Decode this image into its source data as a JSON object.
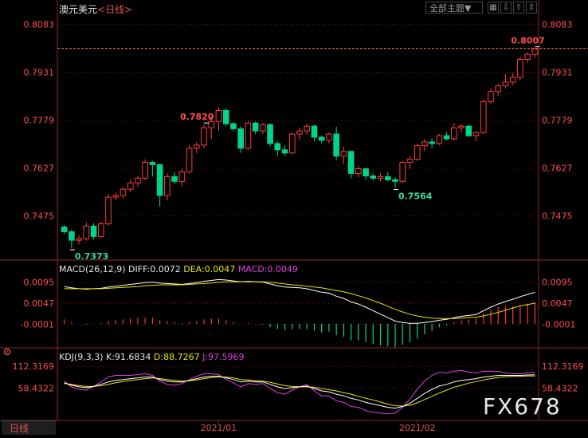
{
  "header": {
    "instrument": "澳元美元",
    "period": "<日线>",
    "mode_select": "全部主题▼",
    "toolbar_icons": [
      "grid-icon",
      "down-arrow-icon",
      "up-arrow-icon",
      "expand-icon"
    ]
  },
  "macd_legend": {
    "name": "MACD(26,12,9)",
    "diff": "DIFF:0.0072",
    "dea": "DEA:0.0047",
    "macd": "MACD:0.0049"
  },
  "kdj_legend": {
    "name": "KDJ(9,3,3)",
    "k": "K:91.6834",
    "d": "D:88.7267",
    "j": "J:97.5969"
  },
  "period_tab": "日线",
  "watermark": "FX678",
  "colors": {
    "up": "#ff3b3b",
    "down": "#00d48a",
    "grid": "#7a1e1e",
    "axis_text": "#ff4d4d",
    "diff": "#ffffff",
    "dea": "#e6e600",
    "macd_hist_pos": "#ff3b3b",
    "macd_hist_neg": "#00d48a",
    "k": "#ffffff",
    "d": "#e6e600",
    "j": "#e040e0"
  },
  "chart_data": [
    {
      "type": "candlestick",
      "title": "澳元美元<日线>",
      "yticks": [
        "0.8083",
        "0.7931",
        "0.7779",
        "0.7627",
        "0.7475"
      ],
      "ylim": [
        0.7335,
        0.8115
      ],
      "x_labels": [
        "2021/01",
        "2021/02"
      ],
      "price_line": 0.8007,
      "annotations": [
        {
          "label": "0.7820",
          "kind": "high",
          "index": 19
        },
        {
          "label": "0.7373",
          "kind": "low",
          "index": 1
        },
        {
          "label": "0.7564",
          "kind": "low",
          "index": 45
        },
        {
          "label": "0.8007",
          "kind": "high",
          "index": 64
        }
      ],
      "ohlc": [
        [
          0.744,
          0.7447,
          0.7418,
          0.7425
        ],
        [
          0.7425,
          0.7432,
          0.7373,
          0.7398
        ],
        [
          0.7398,
          0.7415,
          0.7385,
          0.7403
        ],
        [
          0.7403,
          0.7455,
          0.7397,
          0.7443
        ],
        [
          0.7443,
          0.7452,
          0.74,
          0.741
        ],
        [
          0.741,
          0.7458,
          0.7405,
          0.745
        ],
        [
          0.745,
          0.7545,
          0.7445,
          0.7535
        ],
        [
          0.7535,
          0.755,
          0.7525,
          0.754
        ],
        [
          0.754,
          0.7565,
          0.753,
          0.756
        ],
        [
          0.756,
          0.7592,
          0.755,
          0.758
        ],
        [
          0.758,
          0.7602,
          0.7568,
          0.7595
        ],
        [
          0.7595,
          0.7655,
          0.7588,
          0.7645
        ],
        [
          0.7645,
          0.765,
          0.76,
          0.7638
        ],
        [
          0.7638,
          0.764,
          0.7505,
          0.754
        ],
        [
          0.754,
          0.761,
          0.7525,
          0.76
        ],
        [
          0.76,
          0.7615,
          0.7575,
          0.7585
        ],
        [
          0.7585,
          0.7625,
          0.757,
          0.7615
        ],
        [
          0.7615,
          0.77,
          0.761,
          0.769
        ],
        [
          0.769,
          0.771,
          0.7675,
          0.77
        ],
        [
          0.77,
          0.7765,
          0.769,
          0.7755
        ],
        [
          0.7755,
          0.779,
          0.772,
          0.7775
        ],
        [
          0.7775,
          0.782,
          0.7745,
          0.781
        ],
        [
          0.781,
          0.7818,
          0.776,
          0.7768
        ],
        [
          0.7768,
          0.7773,
          0.7745,
          0.7752
        ],
        [
          0.7752,
          0.776,
          0.7675,
          0.769
        ],
        [
          0.769,
          0.7775,
          0.7685,
          0.777
        ],
        [
          0.777,
          0.7775,
          0.7735,
          0.7745
        ],
        [
          0.7745,
          0.777,
          0.7735,
          0.7765
        ],
        [
          0.7765,
          0.7768,
          0.7695,
          0.7705
        ],
        [
          0.7705,
          0.7712,
          0.7665,
          0.7685
        ],
        [
          0.7685,
          0.77,
          0.7665,
          0.7675
        ],
        [
          0.7675,
          0.774,
          0.767,
          0.7735
        ],
        [
          0.7735,
          0.7755,
          0.7715,
          0.7745
        ],
        [
          0.7745,
          0.7768,
          0.7733,
          0.776
        ],
        [
          0.776,
          0.7765,
          0.7712,
          0.7725
        ],
        [
          0.7725,
          0.773,
          0.7705,
          0.7715
        ],
        [
          0.7715,
          0.774,
          0.7705,
          0.7735
        ],
        [
          0.7735,
          0.7758,
          0.7652,
          0.7665
        ],
        [
          0.7665,
          0.7695,
          0.764,
          0.768
        ],
        [
          0.768,
          0.7682,
          0.7595,
          0.761
        ],
        [
          0.761,
          0.7635,
          0.7598,
          0.7625
        ],
        [
          0.7625,
          0.7628,
          0.759,
          0.7602
        ],
        [
          0.7602,
          0.761,
          0.7586,
          0.7595
        ],
        [
          0.7595,
          0.761,
          0.7585,
          0.76
        ],
        [
          0.76,
          0.7615,
          0.7585,
          0.759
        ],
        [
          0.759,
          0.7598,
          0.7564,
          0.7585
        ],
        [
          0.7585,
          0.765,
          0.758,
          0.7645
        ],
        [
          0.7645,
          0.7665,
          0.7625,
          0.7655
        ],
        [
          0.7655,
          0.7705,
          0.765,
          0.7698
        ],
        [
          0.7698,
          0.772,
          0.7682,
          0.771
        ],
        [
          0.771,
          0.7722,
          0.769,
          0.7705
        ],
        [
          0.7705,
          0.7735,
          0.77,
          0.773
        ],
        [
          0.773,
          0.7742,
          0.7715,
          0.772
        ],
        [
          0.772,
          0.777,
          0.7715,
          0.7755
        ],
        [
          0.7755,
          0.7768,
          0.774,
          0.776
        ],
        [
          0.776,
          0.7765,
          0.7725,
          0.773
        ],
        [
          0.773,
          0.7745,
          0.7712,
          0.774
        ],
        [
          0.774,
          0.7845,
          0.7735,
          0.7838
        ],
        [
          0.7838,
          0.788,
          0.7832,
          0.787
        ],
        [
          0.787,
          0.7895,
          0.7855,
          0.7888
        ],
        [
          0.7888,
          0.7925,
          0.788,
          0.79
        ],
        [
          0.79,
          0.7928,
          0.789,
          0.7915
        ],
        [
          0.7915,
          0.798,
          0.7905,
          0.7972
        ],
        [
          0.7972,
          0.7995,
          0.796,
          0.7988
        ],
        [
          0.7988,
          0.8007,
          0.7978,
          0.8005
        ]
      ]
    },
    {
      "type": "line+bar",
      "title": "MACD(26,12,9)",
      "yticks": [
        "0.0095",
        "0.0047",
        "-0.0001"
      ],
      "ylim": [
        -0.0055,
        0.012
      ],
      "series": [
        {
          "name": "DIFF",
          "values": [
            0.0085,
            0.0082,
            0.008,
            0.0079,
            0.008,
            0.0081,
            0.0084,
            0.0086,
            0.0088,
            0.009,
            0.0092,
            0.0094,
            0.0095,
            0.0093,
            0.0092,
            0.0091,
            0.009,
            0.0092,
            0.0094,
            0.0097,
            0.0099,
            0.0101,
            0.01,
            0.0098,
            0.0096,
            0.0097,
            0.0096,
            0.0095,
            0.0091,
            0.0087,
            0.0084,
            0.0083,
            0.0082,
            0.008,
            0.0076,
            0.0072,
            0.007,
            0.0063,
            0.0058,
            0.005,
            0.0045,
            0.0038,
            0.003,
            0.0022,
            0.0014,
            0.0006,
            0.0003,
            0.0001,
            0.0001,
            0.0003,
            0.0005,
            0.0008,
            0.001,
            0.0014,
            0.0017,
            0.0019,
            0.0021,
            0.003,
            0.0038,
            0.0045,
            0.0051,
            0.0056,
            0.0062,
            0.0067,
            0.0072
          ]
        },
        {
          "name": "DEA",
          "values": [
            0.008,
            0.008,
            0.008,
            0.008,
            0.008,
            0.008,
            0.0081,
            0.0082,
            0.0083,
            0.0084,
            0.0085,
            0.0087,
            0.0088,
            0.0089,
            0.0089,
            0.0089,
            0.0089,
            0.009,
            0.0091,
            0.0092,
            0.0093,
            0.0095,
            0.0096,
            0.0096,
            0.0096,
            0.0096,
            0.0096,
            0.0096,
            0.0095,
            0.0093,
            0.0091,
            0.0089,
            0.0088,
            0.0086,
            0.0084,
            0.0082,
            0.0079,
            0.0076,
            0.0073,
            0.0069,
            0.0064,
            0.0059,
            0.0053,
            0.0047,
            0.004,
            0.0033,
            0.0027,
            0.0022,
            0.0018,
            0.0015,
            0.0013,
            0.0012,
            0.0012,
            0.0012,
            0.0013,
            0.0014,
            0.0015,
            0.0018,
            0.0022,
            0.0026,
            0.0031,
            0.0036,
            0.0041,
            0.0044,
            0.0047
          ]
        },
        {
          "name": "MACD",
          "values": [
            0.001,
            0.0004,
            0.0,
            -0.0002,
            0.0,
            0.0002,
            0.0006,
            0.0008,
            0.001,
            0.0012,
            0.0014,
            0.0014,
            0.0014,
            0.0008,
            0.0006,
            0.0004,
            0.0002,
            0.0004,
            0.0006,
            0.001,
            0.0012,
            0.0012,
            0.0008,
            0.0004,
            0.0,
            0.0002,
            0.0,
            -0.0002,
            -0.0008,
            -0.0012,
            -0.0014,
            -0.0012,
            -0.0012,
            -0.0012,
            -0.0016,
            -0.002,
            -0.0018,
            -0.0026,
            -0.003,
            -0.0038,
            -0.0038,
            -0.0042,
            -0.0046,
            -0.005,
            -0.0052,
            -0.0054,
            -0.0048,
            -0.0042,
            -0.0034,
            -0.0024,
            -0.0016,
            -0.0008,
            -0.0004,
            0.0004,
            0.0008,
            0.001,
            0.0012,
            0.0024,
            0.0032,
            0.0038,
            0.004,
            0.004,
            0.0042,
            0.0046,
            0.0049
          ]
        }
      ]
    },
    {
      "type": "line",
      "title": "KDJ(9,3,3)",
      "yticks": [
        "112.3169",
        "58.4322"
      ],
      "ylim": [
        -20,
        130
      ],
      "series": [
        {
          "name": "K",
          "values": [
            72,
            66,
            62,
            60,
            63,
            68,
            74,
            78,
            80,
            82,
            84,
            86,
            86,
            80,
            76,
            74,
            74,
            78,
            82,
            86,
            88,
            88,
            84,
            80,
            74,
            76,
            74,
            74,
            68,
            62,
            58,
            60,
            62,
            64,
            58,
            52,
            50,
            44,
            40,
            34,
            30,
            24,
            20,
            16,
            12,
            10,
            14,
            22,
            34,
            46,
            56,
            64,
            68,
            74,
            78,
            80,
            82,
            86,
            88,
            90,
            90,
            90,
            90,
            91,
            91.68
          ]
        },
        {
          "name": "D",
          "values": [
            70,
            68,
            65,
            63,
            63,
            65,
            68,
            72,
            75,
            78,
            80,
            82,
            84,
            82,
            80,
            78,
            76,
            77,
            79,
            82,
            85,
            86,
            86,
            84,
            80,
            79,
            77,
            76,
            73,
            69,
            65,
            63,
            62,
            62,
            61,
            58,
            55,
            52,
            48,
            44,
            39,
            34,
            30,
            25,
            20,
            16,
            15,
            17,
            23,
            31,
            39,
            47,
            54,
            61,
            66,
            71,
            75,
            79,
            82,
            85,
            87,
            88,
            88,
            88.5,
            88.73
          ]
        },
        {
          "name": "J",
          "values": [
            76,
            62,
            56,
            54,
            63,
            74,
            86,
            90,
            90,
            90,
            92,
            94,
            90,
            76,
            68,
            66,
            70,
            80,
            88,
            94,
            94,
            92,
            80,
            72,
            62,
            70,
            68,
            70,
            58,
            48,
            44,
            54,
            62,
            68,
            52,
            40,
            40,
            28,
            24,
            14,
            12,
            4,
            0,
            -2,
            -4,
            -2,
            12,
            32,
            56,
            76,
            90,
            98,
            96,
            100,
            102,
            98,
            96,
            100,
            100,
            100,
            96,
            94,
            94,
            96,
            97.6
          ]
        }
      ],
      "yticks_values": [
        112.3169,
        58.4322
      ]
    }
  ]
}
